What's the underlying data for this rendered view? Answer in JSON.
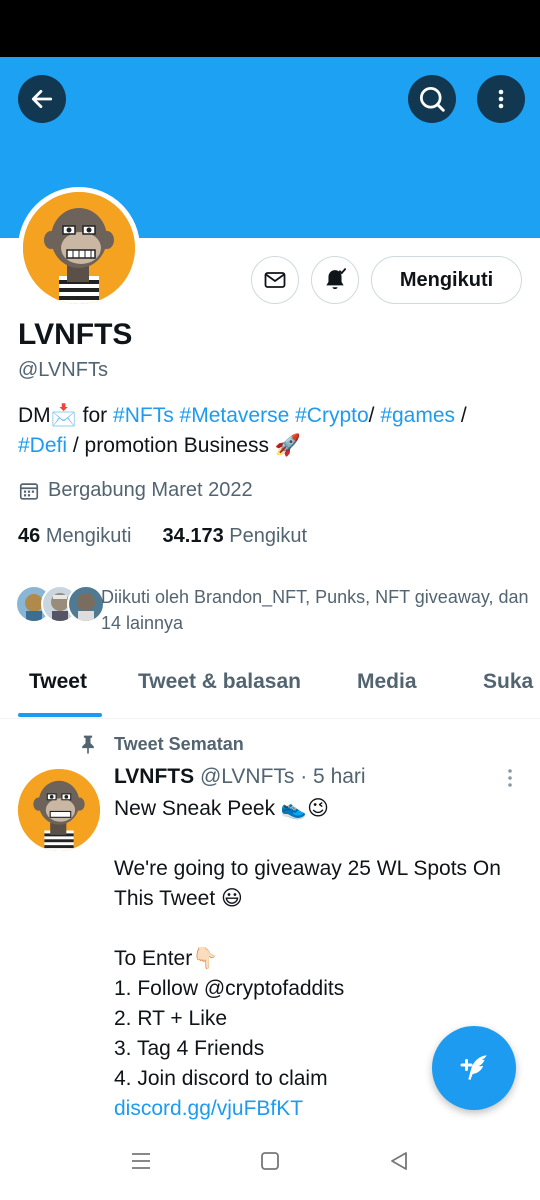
{
  "profile": {
    "name": "LVNFTS",
    "handle": "@LVNFTs",
    "bio": {
      "dm": "DM",
      "dm_emoji": "📩",
      "for": " for ",
      "tag_nfts": "#NFTs",
      "tag_metaverse": "#Metaverse",
      "tag_crypto": "#Crypto",
      "sep1": "/ ",
      "tag_games": "#games",
      "sep2": " /",
      "tag_defi": "#Defi",
      "tail": " / promotion Business ",
      "rocket": "🚀"
    },
    "joined": "Bergabung Maret 2022",
    "following_count": "46",
    "following_label": "Mengikuti",
    "followers_count": "34.173",
    "followers_label": "Pengikut",
    "followed_by": "Diikuti oleh Brandon_NFT, Punks, NFT giveaway, dan 14 lainnya"
  },
  "actions": {
    "follow_state_label": "Mengikuti"
  },
  "tabs": [
    {
      "label": "Tweet"
    },
    {
      "label": "Tweet & balasan"
    },
    {
      "label": "Media"
    },
    {
      "label": "Suka"
    }
  ],
  "tweet": {
    "pinned_label": "Tweet Sematan",
    "author_name": "LVNFTS",
    "author_meta": "@LVNFTs · 5 hari",
    "body": "New Sneak Peek 👟😉\n\nWe're going to giveaway 25 WL Spots On This Tweet 😃\n\nTo Enter👇🏻\n1. Follow @cryptofaddits\n2. RT + Like\n3. Tag 4 Friends\n4. Join discord to claim",
    "link": "discord.gg/vjuFBfKT"
  },
  "icons": {
    "back": "arrow-left-icon",
    "search": "search-icon",
    "more": "more-vertical-icon",
    "message": "mail-icon",
    "notify": "bell-icon",
    "calendar": "calendar-icon",
    "pin": "pin-icon",
    "compose": "compose-tweet-icon"
  },
  "colors": {
    "banner": "#1da1f2",
    "accent": "#1d9bf0",
    "avatar_bg": "#f4a21f"
  }
}
